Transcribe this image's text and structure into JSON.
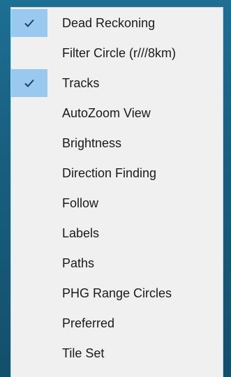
{
  "menu": {
    "items": [
      {
        "label": "Dead Reckoning",
        "checked": true
      },
      {
        "label": "Filter Circle (r///8km)",
        "checked": false
      },
      {
        "label": "Tracks",
        "checked": true
      },
      {
        "label": "AutoZoom View",
        "checked": false
      },
      {
        "label": "Brightness",
        "checked": false
      },
      {
        "label": "Direction Finding",
        "checked": false
      },
      {
        "label": "Follow",
        "checked": false
      },
      {
        "label": "Labels",
        "checked": false
      },
      {
        "label": "Paths",
        "checked": false
      },
      {
        "label": "PHG Range Circles",
        "checked": false
      },
      {
        "label": "Preferred",
        "checked": false
      },
      {
        "label": "Tile Set",
        "checked": false
      }
    ],
    "colors": {
      "check_highlight": "#99c9ef",
      "check_mark": "#1f3f6a",
      "menu_background": "#f0f0f0",
      "text": "#1a1a1a"
    }
  }
}
